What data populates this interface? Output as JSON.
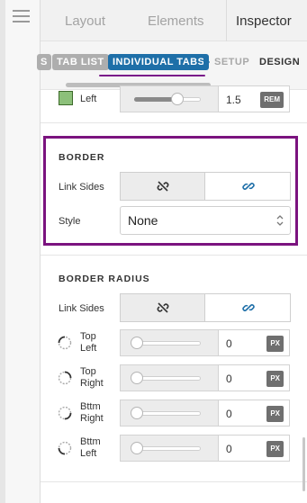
{
  "top_tabs": [
    "Layout",
    "Elements",
    "Inspector"
  ],
  "active_top_tab": "Inspector",
  "breadcrumb": {
    "cut": "S",
    "tab_list": "TAB LIST",
    "individual_tabs": "INDIVIDUAL TABS",
    "setup": "SETUP",
    "design": "DESIGN"
  },
  "left_row": {
    "label": "Left",
    "value": "1.5",
    "unit": "REM",
    "slider_fraction": 0.65,
    "swatch_color": "#8cc07a"
  },
  "border": {
    "title": "BORDER",
    "link_sides_label": "Link Sides",
    "style_label": "Style",
    "style_value": "None"
  },
  "border_radius": {
    "title": "BORDER RADIUS",
    "link_sides_label": "Link Sides",
    "corners": [
      {
        "label_line1": "Top",
        "label_line2": "Left",
        "value": "0",
        "unit": "PX"
      },
      {
        "label_line1": "Top",
        "label_line2": "Right",
        "value": "0",
        "unit": "PX"
      },
      {
        "label_line1": "Bttm",
        "label_line2": "Right",
        "value": "0",
        "unit": "PX"
      },
      {
        "label_line1": "Bttm",
        "label_line2": "Left",
        "value": "0",
        "unit": "PX"
      }
    ]
  },
  "colors": {
    "accent_blue": "#1e6fa8",
    "highlight_purple": "#7b137f",
    "link_icon_blue": "#1e6fa8"
  },
  "icons": {
    "menu": "hamburger-icon",
    "unlinked": "link-broken-icon",
    "linked": "link-icon",
    "select_chevron": "chevron-updown-icon"
  }
}
